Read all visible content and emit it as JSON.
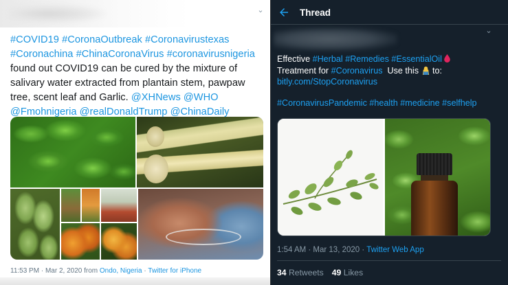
{
  "left_tweet": {
    "text_parts": [
      {
        "text": "#COVID19",
        "kind": "tag"
      },
      {
        "text": " ",
        "kind": "plain"
      },
      {
        "text": "#CoronaOutbreak",
        "kind": "tag"
      },
      {
        "text": " ",
        "kind": "plain"
      },
      {
        "text": "#Coronavirustexas",
        "kind": "tag"
      },
      {
        "text": " ",
        "kind": "plain"
      },
      {
        "text": "#Coronachina",
        "kind": "tag"
      },
      {
        "text": " ",
        "kind": "plain"
      },
      {
        "text": "#ChinaCoronaVirus",
        "kind": "tag"
      },
      {
        "text": " ",
        "kind": "plain"
      },
      {
        "text": "#coronavirusnigeria",
        "kind": "tag"
      },
      {
        "text": " found out COVID19 can be cured by the mixture of salivary water extracted from plantain stem, pawpaw tree, scent leaf and Garlic. ",
        "kind": "plain"
      },
      {
        "text": "@XHNews",
        "kind": "tag"
      },
      {
        "text": " ",
        "kind": "plain"
      },
      {
        "text": "@WHO",
        "kind": "tag"
      },
      {
        "text": " ",
        "kind": "plain"
      },
      {
        "text": "@Fmohnigeria",
        "kind": "tag"
      },
      {
        "text": " ",
        "kind": "plain"
      },
      {
        "text": "@realDonaldTrump",
        "kind": "tag"
      },
      {
        "text": " ",
        "kind": "plain"
      },
      {
        "text": "@ChinaDaily",
        "kind": "tag"
      }
    ],
    "meta": {
      "time": "11:53 PM · Mar 2, 2020 from ",
      "location": "Ondo, Nigeria",
      "sep": " · ",
      "source": "Twitter for iPhone"
    },
    "colors": {
      "link": "#1b95e0",
      "text": "#14171a",
      "meta": "#657786"
    }
  },
  "right_tweet": {
    "header": {
      "title": "Thread",
      "back_icon": "arrow-left-icon"
    },
    "line1": {
      "prefix": "Effective ",
      "tag1": "#Herbal",
      "tag2": "#Remedies",
      "tag3": "#EssentialOil",
      "drop_icon": "blood-drop-icon"
    },
    "line2": {
      "prefix": "Treatment for ",
      "tag": "#Coronavirus",
      "middle": "  Use this ",
      "person_icon": "person-tipping-hand-icon",
      "suffix": " to:"
    },
    "link": "bitly.com/StopCoronavirus",
    "hashtags": [
      "#CoronavirusPandemic",
      "#health",
      "#medicine",
      "#selfhelp"
    ],
    "meta": {
      "time": "1:54 AM · Mar 13, 2020 · ",
      "source": "Twitter Web App"
    },
    "stats": {
      "retweets_count": "34",
      "retweets_label": "Retweets",
      "likes_count": "49",
      "likes_label": "Likes"
    },
    "colors": {
      "background": "#15202b",
      "link": "#1da1f2",
      "meta": "#8899a6",
      "border": "#38444d"
    }
  }
}
